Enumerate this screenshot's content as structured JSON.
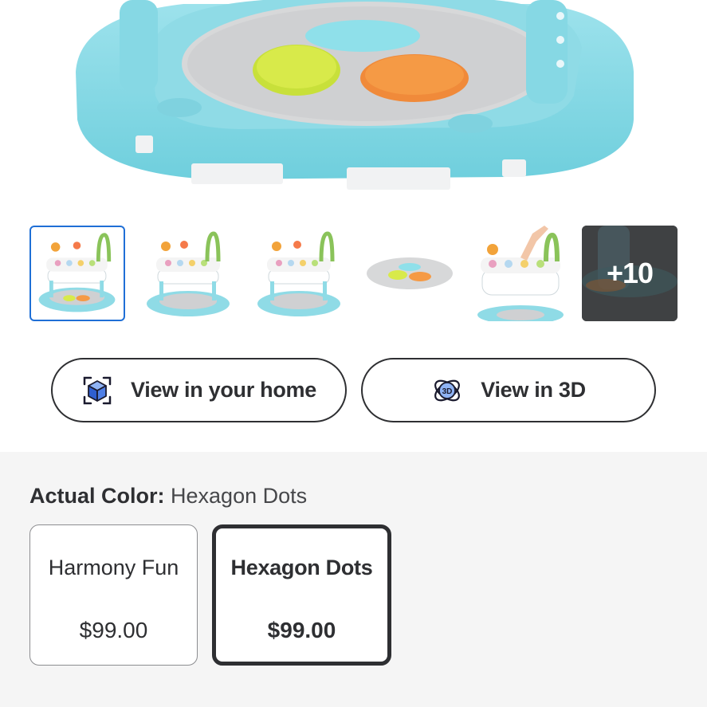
{
  "product_gallery": {
    "main_image_alt": "Activity center base",
    "thumbnails": [
      {
        "name": "thumb-1",
        "selected": true
      },
      {
        "name": "thumb-2",
        "selected": false
      },
      {
        "name": "thumb-3",
        "selected": false
      },
      {
        "name": "thumb-4",
        "selected": false
      },
      {
        "name": "thumb-5",
        "selected": false
      }
    ],
    "more_count_label": "+10"
  },
  "actions": {
    "view_home_label": "View in your home",
    "view_home_icon": "ar-cube-icon",
    "view_3d_label": "View in 3D",
    "view_3d_icon": "3d-rotate-icon"
  },
  "variant": {
    "actual_color_label": "Actual Color:",
    "actual_color_value": "Hexagon Dots",
    "options": [
      {
        "name": "Harmony Fun",
        "price": "$99.00",
        "selected": false
      },
      {
        "name": "Hexagon Dots",
        "price": "$99.00",
        "selected": true
      }
    ]
  },
  "colors": {
    "selected_border": "#1f6fd6",
    "text_primary": "#2e2f32",
    "section_bg": "#f5f5f5",
    "product_teal": "#7fd6e3"
  }
}
